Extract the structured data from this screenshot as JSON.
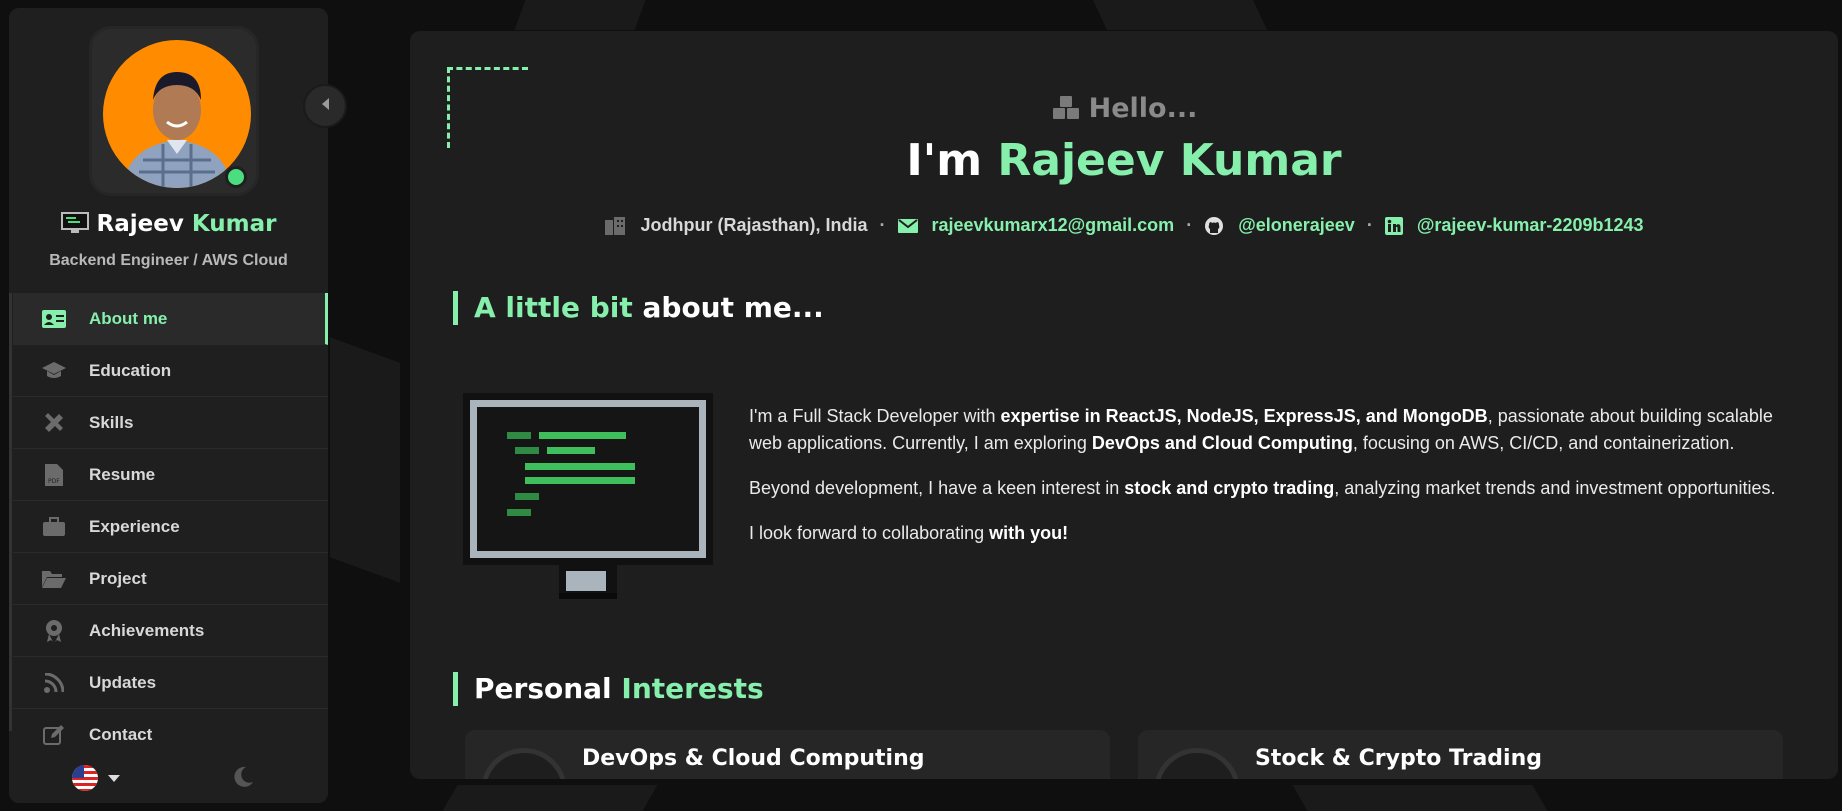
{
  "sidebar": {
    "name_first": "Rajeev",
    "name_last": "Kumar",
    "role": "Backend Engineer / AWS Cloud",
    "status": "online",
    "items": [
      {
        "label": "About me",
        "icon": "id-card-icon",
        "active": true
      },
      {
        "label": "Education",
        "icon": "graduation-cap-icon",
        "active": false
      },
      {
        "label": "Skills",
        "icon": "tools-icon",
        "active": false
      },
      {
        "label": "Resume",
        "icon": "pdf-file-icon",
        "active": false
      },
      {
        "label": "Experience",
        "icon": "briefcase-icon",
        "active": false
      },
      {
        "label": "Project",
        "icon": "folder-open-icon",
        "active": false
      },
      {
        "label": "Achievements",
        "icon": "award-icon",
        "active": false
      },
      {
        "label": "Updates",
        "icon": "rss-icon",
        "active": false
      },
      {
        "label": "Contact",
        "icon": "edit-icon",
        "active": false
      }
    ],
    "language_icon": "us-flag-icon",
    "theme_icon": "moon-icon"
  },
  "header": {
    "hello": "Hello...",
    "headline_prefix": "I'm",
    "headline_name": "Rajeev Kumar"
  },
  "contacts": {
    "location": "Jodhpur (Rajasthan), India",
    "email": "rajeevkumarx12@gmail.com",
    "github": "@elonerajeev",
    "linkedin": "@rajeev-kumar-2209b1243"
  },
  "about": {
    "title_accent": "A little bit",
    "title_rest": "about me...",
    "p1_a": "I'm a Full Stack Developer with ",
    "p1_b": "expertise in ReactJS, NodeJS, ExpressJS, and MongoDB",
    "p1_c": ", passionate about building scalable web applications. Currently, I am exploring ",
    "p1_d": "DevOps and Cloud Computing",
    "p1_e": ", focusing on AWS, CI/CD, and containerization.",
    "p2_a": "Beyond development, I have a keen interest in ",
    "p2_b": "stock and crypto trading",
    "p2_c": ", analyzing market trends and investment opportunities.",
    "p3_a": "I look forward to collaborating ",
    "p3_b": "with you!"
  },
  "interests": {
    "title_prefix": "Personal",
    "title_accent": "Interests",
    "cards": [
      {
        "title": "DevOps & Cloud Computing"
      },
      {
        "title": "Stock & Crypto Trading"
      }
    ]
  },
  "colors": {
    "accent": "#86efac",
    "avatar_bg": "#ff8c00",
    "panel": "#1e1e1e"
  }
}
